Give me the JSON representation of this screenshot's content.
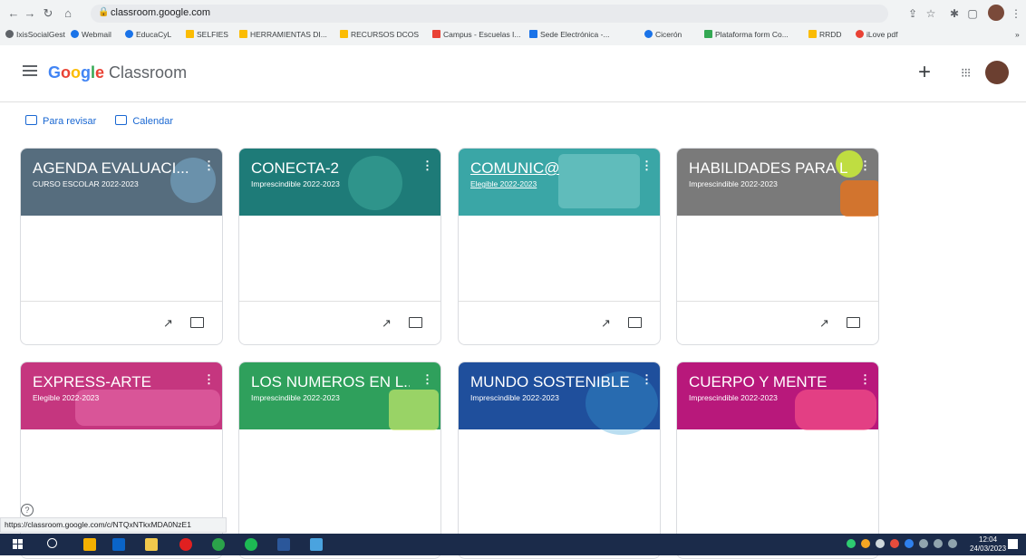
{
  "browser": {
    "url": "classroom.google.com",
    "bookmarks": [
      {
        "label": "IxisSocialGest",
        "color": "#5f6368"
      },
      {
        "label": "Webmail",
        "color": "#1a73e8"
      },
      {
        "label": "EducaCyL",
        "color": "#1a73e8"
      },
      {
        "label": "SELFIES",
        "color": "#fbbc04"
      },
      {
        "label": "HERRAMIENTAS DI...",
        "color": "#fbbc04"
      },
      {
        "label": "RECURSOS DCOS",
        "color": "#fbbc04"
      },
      {
        "label": "Campus - Escuelas I...",
        "color": "#e94235"
      },
      {
        "label": "Sede Electrónica -...",
        "color": "#1a73e8"
      },
      {
        "label": "Cicerón",
        "color": "#1a73e8"
      },
      {
        "label": "Plataforma form Co...",
        "color": "#34a853"
      },
      {
        "label": "RRDD",
        "color": "#fbbc04"
      },
      {
        "label": "iLove pdf",
        "color": "#e94235"
      }
    ],
    "more_bookmarks": "»"
  },
  "header": {
    "logo_google": "Google",
    "logo_product": " Classroom",
    "add_symbol": "+",
    "apps_symbol": "⋮⋮⋮"
  },
  "quick_links": [
    {
      "label": "Para revisar"
    },
    {
      "label": "Calendar"
    }
  ],
  "courses": [
    {
      "title": "AGENDA EVALUACI...",
      "subtitle": "CURSO ESCOLAR 2022-2023",
      "color": "#566d7e"
    },
    {
      "title": "CONECTA-2",
      "subtitle": "Imprescindible 2022-2023",
      "color": "#1e7b78"
    },
    {
      "title": "COMUNIC@",
      "subtitle": "Elegible 2022-2023",
      "color": "#3aa6a6"
    },
    {
      "title": "HABILIDADES PARA L...",
      "subtitle": "Imprescindible 2022-2023",
      "color": "#7a7a7a"
    },
    {
      "title": "EXPRESS-ARTE",
      "subtitle": "Elegible 2022-2023",
      "color": "#c5367f"
    },
    {
      "title": "LOS NUMEROS EN L...",
      "subtitle": "Imprescindible 2022-2023",
      "color": "#2fa05c"
    },
    {
      "title": "MUNDO SOSTENIBLE",
      "subtitle": "Imprescindible 2022-2023",
      "color": "#1f4f9c"
    },
    {
      "title": "CUERPO Y MENTE",
      "subtitle": "Imprescindible 2022-2023",
      "color": "#b8187b"
    }
  ],
  "card_icons": {
    "trend": "↗",
    "folder": "folder-icon",
    "more": "⋮"
  },
  "status_url": "https://classroom.google.com/c/NTQxNTkxMDA0NzE1",
  "help_symbol": "?",
  "clock": {
    "time": "12:04",
    "date": "24/03/2023"
  }
}
